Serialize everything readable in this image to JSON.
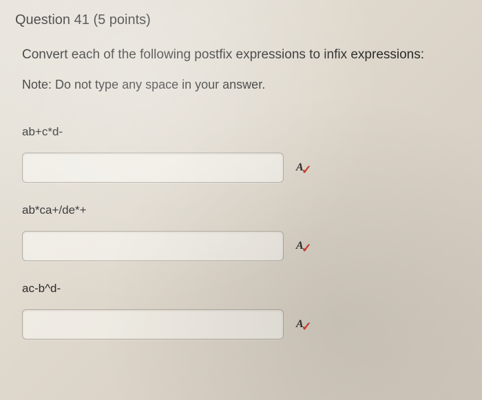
{
  "header": {
    "question_label": "Question",
    "question_number": "41",
    "points_text": "(5 points)"
  },
  "instruction": "Convert each of the following postfix expressions to infix expressions:",
  "note": "Note: Do not type any space in your answer.",
  "expressions": [
    {
      "label": "ab+c*d-",
      "value": ""
    },
    {
      "label": "ab*ca+/de*+",
      "value": ""
    },
    {
      "label": "ac-b^d-",
      "value": ""
    }
  ],
  "icon": {
    "letter": "A",
    "check": "✓"
  }
}
